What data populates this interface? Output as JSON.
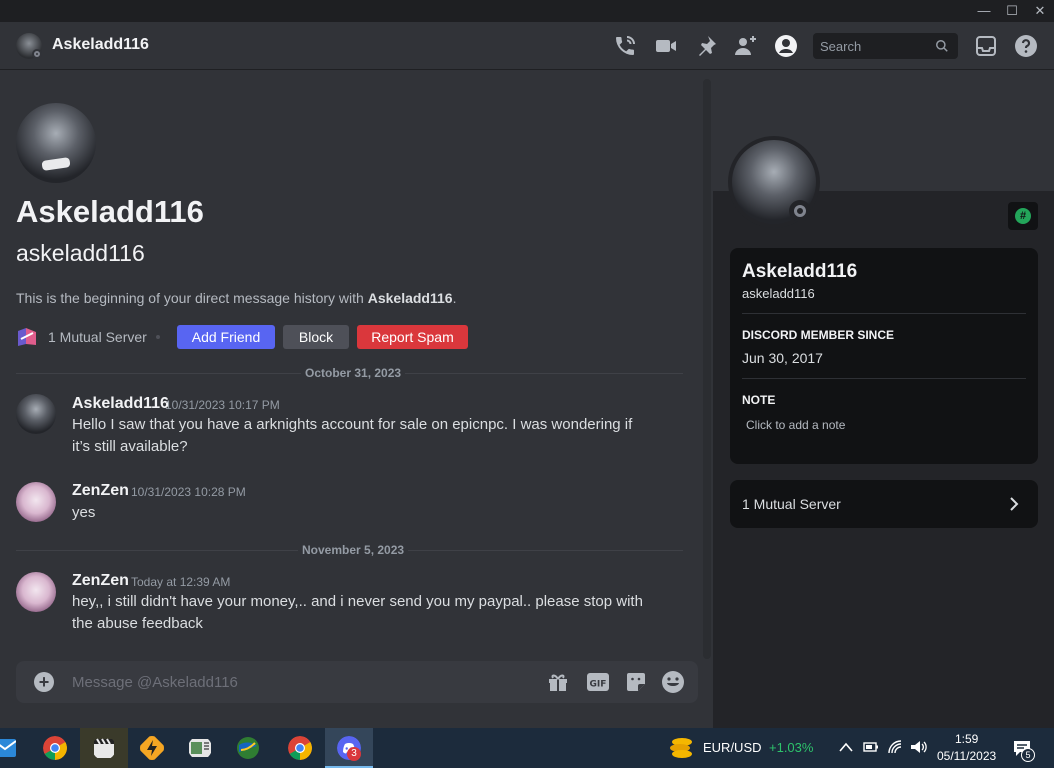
{
  "window": {
    "minimize": "—",
    "maximize": "☐",
    "close": "✕"
  },
  "header": {
    "title": "Askeladd116",
    "search_placeholder": "Search",
    "icons": [
      "phone-call-icon",
      "video-call-icon",
      "pin-icon",
      "add-friend-icon",
      "user-profile-icon",
      "inbox-icon",
      "help-icon"
    ]
  },
  "intro": {
    "display_name": "Askeladd116",
    "username": "askeladd116",
    "text_prefix": "This is the beginning of your direct message history with ",
    "text_name": "Askeladd116",
    "text_suffix": ".",
    "mutual_servers": "1 Mutual Server",
    "add_friend": "Add Friend",
    "block": "Block",
    "report_spam": "Report Spam"
  },
  "dividers": [
    "October 31, 2023",
    "November 5, 2023"
  ],
  "messages": [
    {
      "author": "Askeladd116",
      "time": "10/31/2023 10:17 PM",
      "text": "Hello I saw that you have a arknights account for sale on epicnpc. I was wondering if it’s still available?"
    },
    {
      "author": "ZenZen",
      "time": "10/31/2023 10:28 PM",
      "text": "yes"
    },
    {
      "author": "ZenZen",
      "time": "Today at 12:39 AM",
      "text": "hey,, i still didn't have your money,.. and i never send you my paypal.. please stop with the abuse feedback"
    }
  ],
  "composer": {
    "placeholder": "Message @Askeladd116"
  },
  "profile": {
    "display_name": "Askeladd116",
    "username": "askeladd116",
    "member_since_label": "DISCORD MEMBER SINCE",
    "member_since": "Jun 30, 2017",
    "note_label": "NOTE",
    "note_placeholder": "Click to add a note",
    "mutual_servers": "1 Mutual Server"
  },
  "taskbar": {
    "ticker_pair": "EUR/USD",
    "ticker_change": "+1.03%",
    "time": "1:59",
    "date": "05/11/2023",
    "discord_badge": "3",
    "notification_count": "5"
  },
  "colors": {
    "blurple": "#5865f2",
    "danger": "#da373c",
    "secondary": "#4e5058",
    "positive": "#2dc26b"
  }
}
